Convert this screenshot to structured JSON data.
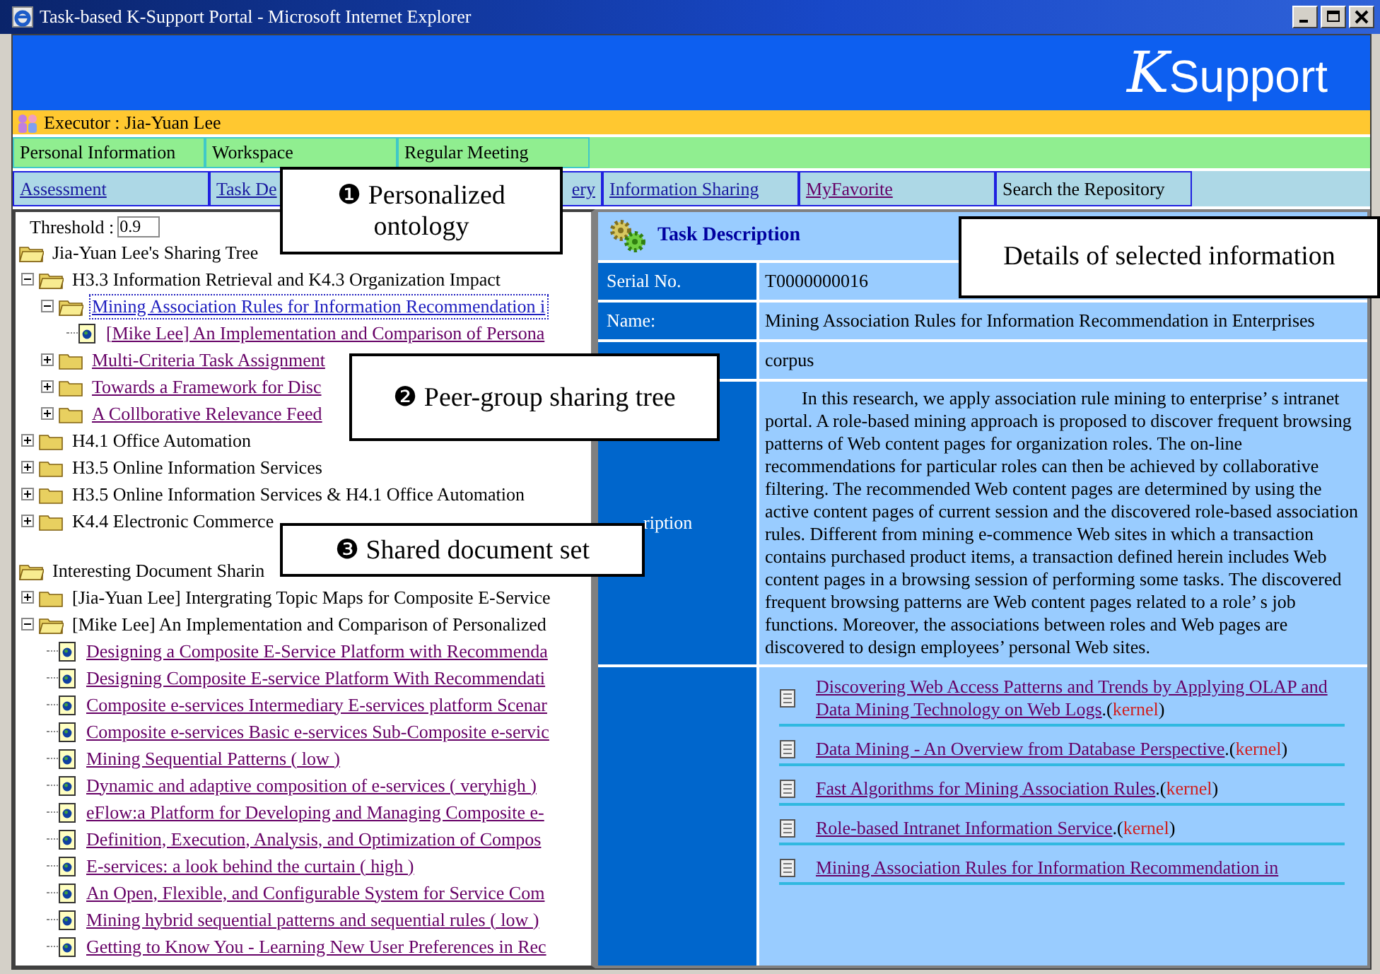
{
  "window": {
    "title": "Task-based K-Support Portal - Microsoft Internet Explorer"
  },
  "logo": {
    "letter": "K",
    "word": "Support"
  },
  "executor": "Executor : Jia-Yuan Lee",
  "menu_row_1": [
    {
      "label": "Personal Information"
    },
    {
      "label": "Workspace"
    },
    {
      "label": "Regular Meeting"
    }
  ],
  "menu_row_2": [
    {
      "label": "Assessment",
      "link": true
    },
    {
      "label": "Task De",
      "link": true
    },
    {
      "label": "ery",
      "link": true
    },
    {
      "label": "Information Sharing",
      "link": true
    },
    {
      "label": "MyFavorite",
      "link": true
    },
    {
      "label": "Search the Repository",
      "link": false
    }
  ],
  "threshold": {
    "label": "Threshold :",
    "value": "0.9"
  },
  "trees": [
    {
      "label": "Jia-Yuan Lee's Sharing Tree",
      "kind": "folder",
      "link": false,
      "expanded": true,
      "selected": false,
      "children": [
        {
          "label": "H3.3 Information Retrieval and K4.3 Organization Impact",
          "kind": "folder",
          "link": false,
          "expanded": true,
          "selected": false,
          "children": [
            {
              "label": "Mining Association Rules for Information Recommendation i",
              "kind": "folder",
              "link": true,
              "expanded": true,
              "selected": true,
              "children": [
                {
                  "label": "[Mike Lee] An Implementation and Comparison of Persona",
                  "kind": "document",
                  "link": true,
                  "selected": false
                }
              ]
            },
            {
              "label": "Multi-Criteria Task Assignment",
              "kind": "folder",
              "link": true,
              "expanded": false,
              "selected": false
            },
            {
              "label": "Towards a Framework for Disc",
              "kind": "folder",
              "link": true,
              "expanded": false,
              "selected": false
            },
            {
              "label": "A Collborative Relevance Feed",
              "kind": "folder",
              "link": true,
              "expanded": false,
              "selected": false
            }
          ]
        },
        {
          "label": "H4.1 Office Automation",
          "kind": "folder",
          "link": false,
          "expanded": false,
          "selected": false
        },
        {
          "label": "H3.5 Online Information Services",
          "kind": "folder",
          "link": false,
          "expanded": false,
          "selected": false
        },
        {
          "label": "H3.5 Online Information Services & H4.1 Office Automation",
          "kind": "folder",
          "link": false,
          "expanded": false,
          "selected": false
        },
        {
          "label": "K4.4 Electronic Commerce",
          "kind": "folder",
          "link": false,
          "expanded": false,
          "selected": false
        }
      ]
    },
    {
      "label": "Interesting Document Sharin",
      "kind": "folder",
      "link": false,
      "expanded": true,
      "selected": false,
      "children": [
        {
          "label": "[Jia-Yuan Lee] Intergrating Topic Maps for Composite E-Service",
          "kind": "folder",
          "link": false,
          "expanded": false,
          "selected": false
        },
        {
          "label": "[Mike Lee] An Implementation and Comparison of Personalized",
          "kind": "folder",
          "link": false,
          "expanded": true,
          "selected": false,
          "children": [
            {
              "label": "Designing a Composite E-Service Platform with Recommenda",
              "kind": "document",
              "link": true,
              "selected": false
            },
            {
              "label": "Designing Composite E-service Platform With Recommendati",
              "kind": "document",
              "link": true,
              "selected": false
            },
            {
              "label": "Composite e-services Intermediary E-services platform Scenar",
              "kind": "document",
              "link": true,
              "selected": false
            },
            {
              "label": "Composite e-services Basic e-services Sub-Composite e-servic",
              "kind": "document",
              "link": true,
              "selected": false
            },
            {
              "label": "Mining Sequential Patterns ( low )",
              "kind": "document",
              "link": true,
              "selected": false
            },
            {
              "label": "Dynamic and adaptive composition of e-services ( veryhigh )",
              "kind": "document",
              "link": true,
              "selected": false
            },
            {
              "label": "eFlow:a Platform for Developing and Managing Composite e-",
              "kind": "document",
              "link": true,
              "selected": false
            },
            {
              "label": "Definition, Execution, Analysis, and Optimization of Compos",
              "kind": "document",
              "link": true,
              "selected": false
            },
            {
              "label": "E-services: a look behind the curtain ( high )",
              "kind": "document",
              "link": true,
              "selected": false
            },
            {
              "label": "An Open, Flexible, and Configurable System for Service Com",
              "kind": "document",
              "link": true,
              "selected": false
            },
            {
              "label": "Mining hybrid sequential patterns and sequential rules ( low )",
              "kind": "document",
              "link": true,
              "selected": false
            },
            {
              "label": "Getting to Know You - Learning New User Preferences in Rec",
              "kind": "document",
              "link": true,
              "selected": false
            }
          ]
        }
      ]
    }
  ],
  "details": {
    "title": "Task Description",
    "rows": [
      {
        "label": "Serial No.",
        "value": "T0000000016",
        "kind": "text"
      },
      {
        "label": "Name:",
        "value": "Mining Association Rules for Information Recommendation in Enterprises",
        "kind": "text"
      },
      {
        "value": "corpus",
        "kind": "text"
      },
      {
        "label": "ription",
        "kind": "paragraph",
        "value": "In this research, we apply association rule mining to enterprise’ s intranet portal. A role-based mining approach is proposed to discover frequent browsing patterns of Web content pages for organization roles. The on-line recommendations for particular roles can then be achieved by collaborative filtering. The recommended Web content pages are determined by using the active content pages of current session and the discovered role-based association rules. Different from mining e-commence Web sites in which a transaction contains purchased product items, a transaction defined herein includes Web content pages in a browsing session of performing some tasks. The discovered frequent browsing patterns are Web content pages related to a role’ s job functions. Moreover, the associations between roles and Web pages are discovered to design employees’ personal Web sites."
      }
    ],
    "references": [
      {
        "title": "Discovering Web Access Patterns and Trends by Applying OLAP and Data Mining Technology on Web Logs",
        "open": ".(",
        "tag": "kernel",
        "close": ")"
      },
      {
        "title": "Data Mining - An Overview from Database Perspective",
        "open": ".(",
        "tag": "kernel",
        "close": ")"
      },
      {
        "title": "Fast Algorithms for Mining Association Rules",
        "open": ".(",
        "tag": "kernel",
        "close": ")"
      },
      {
        "title": "Role-based Intranet Information Service",
        "open": ".(",
        "tag": "kernel",
        "close": ")"
      },
      {
        "title": "Mining Association Rules for Information Recommendation in"
      }
    ]
  },
  "annotations": [
    {
      "number": "❶",
      "text": "Personalized ontology"
    },
    {
      "number": "❷",
      "text": "Peer-group sharing tree"
    },
    {
      "number": "❸",
      "text": "Shared document set"
    },
    {
      "text": "Details of selected information"
    }
  ]
}
